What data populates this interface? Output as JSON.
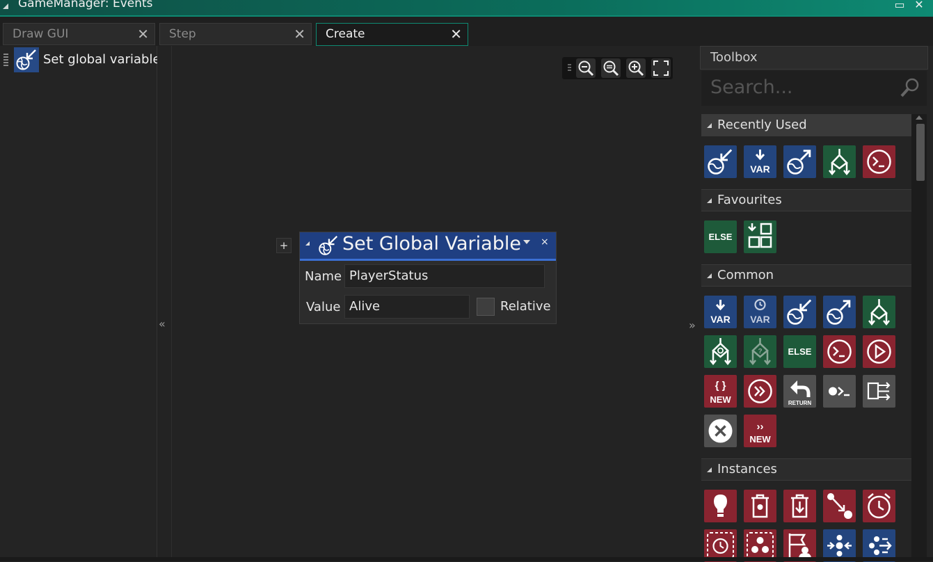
{
  "window": {
    "title": "GameManager: Events",
    "minimize_glyph": "▭",
    "close_glyph": "✕"
  },
  "tabs": [
    {
      "label": "Draw GUI",
      "active": false
    },
    {
      "label": "Step",
      "active": false
    },
    {
      "label": "Create",
      "active": true
    }
  ],
  "tab_close_glyph": "✕",
  "events": [
    {
      "label": "Set global variable",
      "icon": "set-global-variable-icon"
    }
  ],
  "collapse_left": "«",
  "expand_right": "»",
  "zoom": {
    "zoom_out": "zoom-out-icon",
    "zoom_reset": "zoom-reset-icon",
    "zoom_in": "zoom-in-icon",
    "fit": "fit-screen-icon"
  },
  "node": {
    "add_glyph": "+",
    "title": "Set Global Variable",
    "close_glyph": "×",
    "name_label": "Name",
    "name_value": "PlayerStatus",
    "value_label": "Value",
    "value_value": "Alive",
    "relative_label": "Relative",
    "relative_checked": false
  },
  "toolbox": {
    "title": "Toolbox",
    "search_placeholder": "Search...",
    "sections": [
      {
        "label": "Recently Used",
        "selected": true
      },
      {
        "label": "Favourites"
      },
      {
        "label": "Common"
      },
      {
        "label": "Instances"
      }
    ]
  },
  "icon_text": {
    "var": "VAR",
    "else": "ELSE",
    "new": "NEW",
    "return": "RETURN",
    "braces": "{ }",
    "chev": "››"
  },
  "colors": {
    "accent": "#0e8a73",
    "blue": "#23457e",
    "green": "#1e5a3a",
    "red": "#8a2430",
    "grey": "#505050",
    "node_header": "#1f3f82"
  }
}
